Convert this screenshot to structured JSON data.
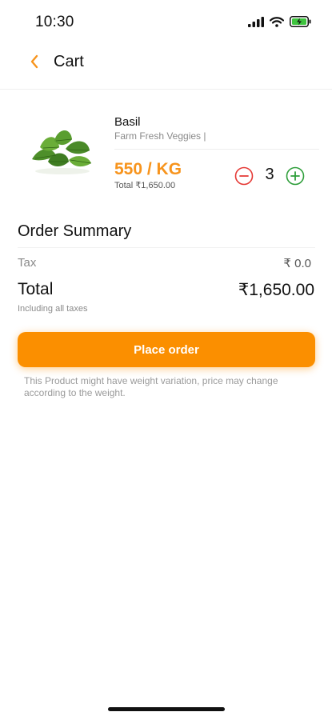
{
  "status_bar": {
    "time": "10:30",
    "icons": [
      "signal-icon",
      "wifi-icon",
      "battery-charging-icon"
    ]
  },
  "header": {
    "back_icon": "chevron-left-icon",
    "title": "Cart"
  },
  "cart": {
    "items": [
      {
        "name": "Basil",
        "vendor": "Farm Fresh Veggies |",
        "price": "550 / KG",
        "total": "Total ₹1,650.00",
        "quantity": "3",
        "image": "basil-leaves-image"
      }
    ]
  },
  "order_summary": {
    "title": "Order Summary",
    "tax_label": "Tax",
    "tax_value": "₹ 0.0",
    "total_label": "Total",
    "total_value": "₹1,650.00",
    "total_note": "Including all taxes"
  },
  "actions": {
    "place_order_label": "Place order"
  },
  "disclaimer": "This Product might have weight variation, price may change according to the weight.",
  "colors": {
    "accent": "#fb8f00",
    "price": "#f7941d",
    "minus": "#e53935",
    "plus": "#2e9e3a"
  }
}
